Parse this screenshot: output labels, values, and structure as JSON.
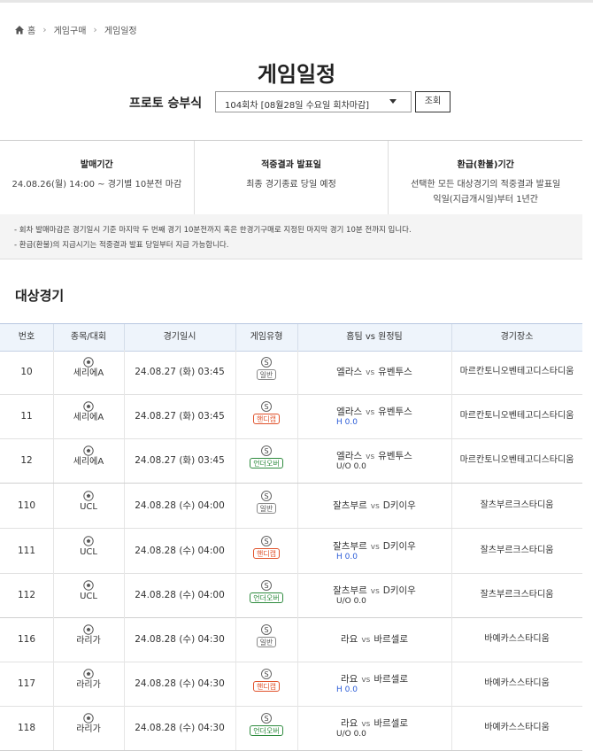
{
  "breadcrumb": {
    "home": "홈",
    "level1": "게임구매",
    "level2": "게임일정"
  },
  "page_title": "게임일정",
  "selector": {
    "label": "프로토 승부식",
    "value": "104회차 [08월28일 수요일 회차마감]",
    "button": "조회"
  },
  "info": [
    {
      "heading": "발매기간",
      "lines": [
        "24.08.26(월) 14:00 ~ 경기별 10분전 마감"
      ]
    },
    {
      "heading": "적중결과 발표일",
      "lines": [
        "최종 경기종료 당일 예정"
      ]
    },
    {
      "heading": "환급(환불)기간",
      "lines": [
        "선택한 모든 대상경기의 적중결과 발표일",
        "익일(지급개시일)부터 1년간"
      ]
    }
  ],
  "notes": [
    "- 회차 발매마감은 경기일시 기준 마지막 두 번째 경기 10분전까지 혹은 한경기구매로 지정된 마지막 경기 10분 전까지 입니다.",
    "- 환급(환불)의 지급시기는 적중결과 발표 당일부터 지급 가능합니다."
  ],
  "section_title": "대상경기",
  "table": {
    "headers": [
      "번호",
      "종목/대회",
      "경기일시",
      "게임유형",
      "홈팀 vs 원정팀",
      "경기장소"
    ],
    "vs": "vs",
    "badge_letter": "S",
    "rows": [
      {
        "no": "10",
        "league": "세리에A",
        "datetime": "24.08.27 (화) 03:45",
        "type": "일반",
        "home": "엘라스",
        "away": "유벤투스",
        "handicap": "",
        "venue": "마르칸토니오벤테고디스타디움"
      },
      {
        "no": "11",
        "league": "세리에A",
        "datetime": "24.08.27 (화) 03:45",
        "type": "핸디캡",
        "home": "엘라스",
        "away": "유벤투스",
        "handicap": "H 0.0",
        "venue": "마르칸토니오벤테고디스타디움"
      },
      {
        "no": "12",
        "league": "세리에A",
        "datetime": "24.08.27 (화) 03:45",
        "type": "언더오버",
        "home": "엘라스",
        "away": "유벤투스",
        "handicap": "U/O 0.0",
        "venue": "마르칸토니오벤테고디스타디움"
      },
      {
        "no": "110",
        "league": "UCL",
        "datetime": "24.08.28 (수) 04:00",
        "type": "일반",
        "home": "잘츠부르",
        "away": "D키이우",
        "handicap": "",
        "venue": "잘츠부르크스타디움"
      },
      {
        "no": "111",
        "league": "UCL",
        "datetime": "24.08.28 (수) 04:00",
        "type": "핸디캡",
        "home": "잘츠부르",
        "away": "D키이우",
        "handicap": "H 0.0",
        "venue": "잘츠부르크스타디움"
      },
      {
        "no": "112",
        "league": "UCL",
        "datetime": "24.08.28 (수) 04:00",
        "type": "언더오버",
        "home": "잘츠부르",
        "away": "D키이우",
        "handicap": "U/O 0.0",
        "venue": "잘츠부르크스타디움"
      },
      {
        "no": "116",
        "league": "라리가",
        "datetime": "24.08.28 (수) 04:30",
        "type": "일반",
        "home": "라요",
        "away": "바르셀로",
        "handicap": "",
        "venue": "바예카스스타디움"
      },
      {
        "no": "117",
        "league": "라리가",
        "datetime": "24.08.28 (수) 04:30",
        "type": "핸디캡",
        "home": "라요",
        "away": "바르셀로",
        "handicap": "H 0.0",
        "venue": "바예카스스타디움"
      },
      {
        "no": "118",
        "league": "라리가",
        "datetime": "24.08.28 (수) 04:30",
        "type": "언더오버",
        "home": "라요",
        "away": "바르셀로",
        "handicap": "U/O 0.0",
        "venue": "바예카스스타디움"
      }
    ]
  },
  "colors": {
    "handicap_badge": "#e0522b",
    "underover_badge": "#2e8b3e",
    "handicap_text": "#2a5bd7",
    "header_bg": "#eef4fb"
  }
}
